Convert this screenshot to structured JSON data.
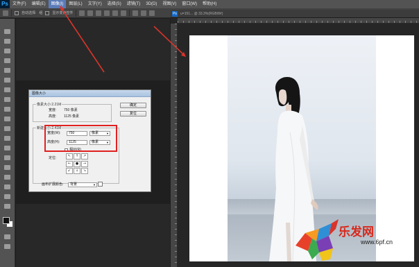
{
  "app": {
    "logo": "Ps",
    "menu": [
      "文件(F)",
      "编辑(E)",
      "图像(I)",
      "图层(L)",
      "文字(Y)",
      "选择(S)",
      "滤镜(T)",
      "3D(D)",
      "视图(V)",
      "窗口(W)",
      "帮助(H)"
    ],
    "active_menu_index": 2
  },
  "options_bar": {
    "labels": [
      "自动选择:",
      "组",
      "显示变换控件"
    ]
  },
  "document": {
    "tab_icon": "Ps",
    "tab_title": "u=151... @ 33.3%(RGB/8#)",
    "close_glyph": "✕"
  },
  "dialog": {
    "title": "图像大小",
    "pixel_dims_legend": "像素大小:2.21M",
    "pixel_width_label": "宽度:",
    "pixel_width_value": "750 像素",
    "pixel_height_label": "高度:",
    "pixel_height_value": "1125 像素",
    "ok_label": "确定",
    "cancel_label": "复位",
    "canvas_legend": "新建大小:2.41M",
    "width_label": "宽度(W):",
    "width_value": "750",
    "width_unit": "像素",
    "height_label": "高度(H):",
    "height_value": "1125",
    "height_unit": "像素",
    "relative_label": "相对(R)",
    "anchor_label": "定位:",
    "anchor_arrows": [
      "↖",
      "↑",
      "↗",
      "←",
      "●",
      "→",
      "↙",
      "↓",
      "↘"
    ],
    "ext_color_label": "画布扩展颜色:",
    "ext_color_value": "背景"
  },
  "watermark": {
    "text": "乐发网",
    "url": "www.6pf.cn"
  },
  "colors": {
    "menubar": "#535353",
    "accent": "#5b7bb8",
    "highlight": "#e02020",
    "annotation_arrow": "#d9342b"
  },
  "icons": [
    "move-tool-icon",
    "marquee-tool-icon",
    "lasso-tool-icon",
    "magic-wand-icon",
    "crop-tool-icon",
    "eyedropper-icon",
    "brush-icon",
    "stamp-icon",
    "eraser-icon",
    "gradient-icon",
    "pen-icon",
    "text-tool-icon",
    "path-select-icon",
    "shape-tool-icon",
    "hand-tool-icon",
    "zoom-tool-icon"
  ]
}
